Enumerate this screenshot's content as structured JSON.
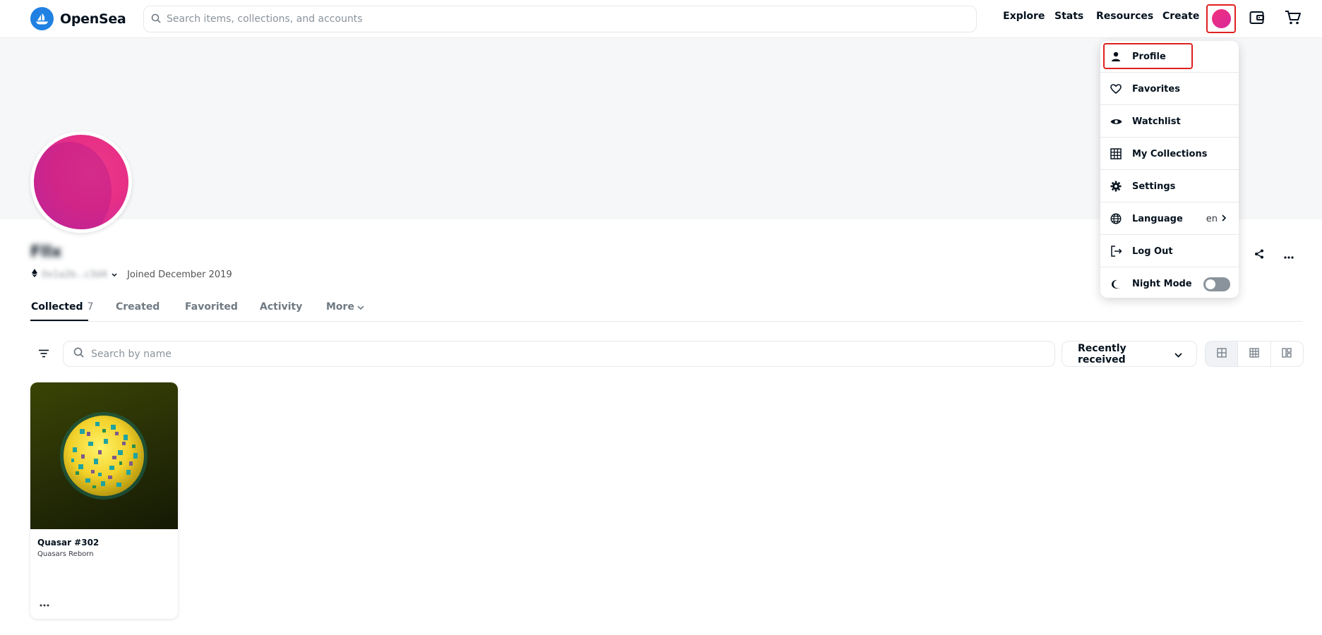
{
  "header": {
    "logo_text": "OpenSea",
    "search_placeholder": "Search items, collections, and accounts",
    "nav": {
      "explore": "Explore",
      "stats": "Stats",
      "resources": "Resources",
      "create": "Create"
    }
  },
  "profile": {
    "name": "Fllx",
    "address": "0x1a2b...c3d4",
    "joined": "Joined December 2019"
  },
  "tabs": {
    "collected": "Collected",
    "collected_count": "7",
    "created": "Created",
    "favorited": "Favorited",
    "activity": "Activity",
    "more": "More"
  },
  "filters": {
    "search_placeholder": "Search by name",
    "sort_value": "Recently received"
  },
  "items": [
    {
      "title": "Quasar #302",
      "collection": "Quasars Reborn"
    }
  ],
  "dropdown": {
    "profile": "Profile",
    "favorites": "Favorites",
    "watchlist": "Watchlist",
    "my_collections": "My Collections",
    "settings": "Settings",
    "language": "Language",
    "language_value": "en",
    "log_out": "Log Out",
    "night_mode": "Night Mode"
  },
  "colors": {
    "brand": "#2081e2",
    "avatar": "#e72f86",
    "highlight": "#e02020"
  }
}
